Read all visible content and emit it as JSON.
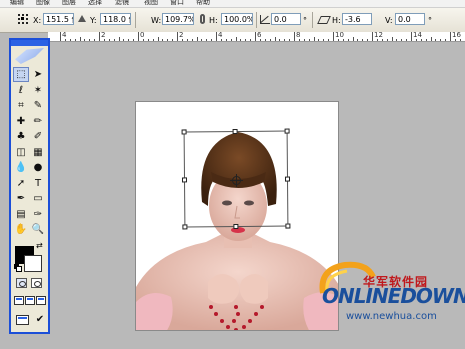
{
  "menubar": {
    "items": [
      "编辑",
      "图像",
      "图层",
      "选择",
      "滤镜",
      "视图",
      "窗口",
      "帮助"
    ]
  },
  "options": {
    "x_label": "X:",
    "x_value": "151.5 像",
    "y_label": "Y:",
    "y_value": "118.0 像",
    "w_label": "W:",
    "w_value": "109.7%",
    "h_label": "H:",
    "h_value": "100.0%",
    "rotate_value": "0.0",
    "skew_h_label": "H:",
    "skew_h_value": "-3.6",
    "skew_v_label": "V:",
    "skew_v_value": "0.0",
    "degree_symbol": "°"
  },
  "ruler": {
    "labels": [
      "4",
      "2",
      "0",
      "2",
      "4",
      "6",
      "8",
      "10",
      "12",
      "14",
      "16"
    ]
  },
  "toolbox": {
    "tools": [
      "marquee",
      "move",
      "lasso",
      "magic-wand",
      "crop",
      "slice",
      "healing-brush",
      "brush",
      "clone-stamp",
      "history-brush",
      "eraser",
      "gradient",
      "blur",
      "dodge",
      "path-selection",
      "type",
      "pen",
      "shape",
      "notes",
      "eyedropper",
      "hand",
      "zoom"
    ],
    "glyphs": [
      "⬚",
      "➤",
      "ℓ",
      "✶",
      "⌗",
      "✎",
      "✚",
      "✏",
      "♣",
      "✐",
      "◫",
      "▦",
      "💧",
      "●",
      "➚",
      "T",
      "✒",
      "▭",
      "▤",
      "✑",
      "✋",
      "🔍"
    ],
    "foreground_color": "#000000",
    "background_color": "#ffffff",
    "swap_glyph": "⇄"
  },
  "watermark": {
    "cn_text": "华军软件园",
    "logo_text": "ONLINEDOWN",
    "url": "www.newhua.com"
  },
  "colors": {
    "menubar_bg": "#f2f2f2",
    "options_bg": "#ece9d8",
    "workspace_bg": "#b9b9b9",
    "toolbox_border": "#1c4fd8",
    "watermark_red": "#c0181c",
    "watermark_blue": "#1a4f9c"
  }
}
